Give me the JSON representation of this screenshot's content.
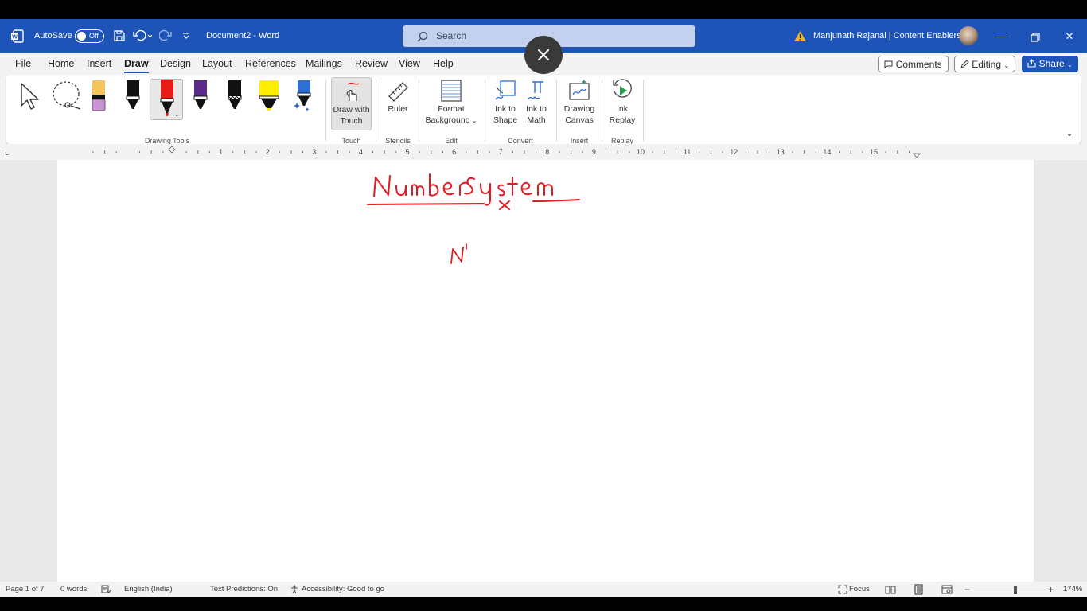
{
  "titlebar": {
    "autosave_label": "AutoSave",
    "toggle_state": "Off",
    "doc_title": "Document2 - Word",
    "search_placeholder": "Search",
    "user": "Manjunath Rajanal | Content Enablers"
  },
  "menu": {
    "tabs": [
      "File",
      "Home",
      "Insert",
      "Draw",
      "Design",
      "Layout",
      "References",
      "Mailings",
      "Review",
      "View",
      "Help"
    ],
    "active_tab": "Draw",
    "comments": "Comments",
    "editing": "Editing",
    "share": "Share"
  },
  "ribbon": {
    "groups": {
      "drawing_tools": "Drawing Tools",
      "touch": "Touch",
      "stencils": "Stencils",
      "edit": "Edit",
      "convert": "Convert",
      "insert": "Insert",
      "replay": "Replay"
    },
    "buttons": {
      "draw_with_touch": [
        "Draw with",
        "Touch"
      ],
      "ruler": [
        "Ruler"
      ],
      "format_background": [
        "Format",
        "Background"
      ],
      "ink_to_shape": [
        "Ink to",
        "Shape"
      ],
      "ink_to_math": [
        "Ink to",
        "Math"
      ],
      "drawing_canvas": [
        "Drawing",
        "Canvas"
      ],
      "ink_replay": [
        "Ink",
        "Replay"
      ]
    },
    "pens": [
      {
        "name": "black-pen",
        "color": "#111111"
      },
      {
        "name": "red-pen",
        "color": "#e81b1b"
      },
      {
        "name": "purple-pen",
        "color": "#5b2a8c"
      },
      {
        "name": "black-marker",
        "color": "#111111"
      },
      {
        "name": "yellow-highlighter",
        "color": "#ffee00"
      },
      {
        "name": "blue-galaxy-pen",
        "color": "#2c6fd6"
      }
    ]
  },
  "ruler": {
    "numbers": [
      "1",
      "2",
      "3",
      "4",
      "5",
      "6",
      "7",
      "8",
      "9",
      "10",
      "11",
      "12",
      "13",
      "14",
      "15"
    ]
  },
  "document": {
    "ink_heading": "Numbersystem",
    "ink_color": "#e21b23"
  },
  "status": {
    "page": "Page 1 of 7",
    "words": "0 words",
    "language": "English (India)",
    "text_predictions": "Text Predictions: On",
    "accessibility": "Accessibility: Good to go",
    "focus": "Focus",
    "zoom": "174%"
  },
  "colors": {
    "accent": "#1e54b7"
  }
}
